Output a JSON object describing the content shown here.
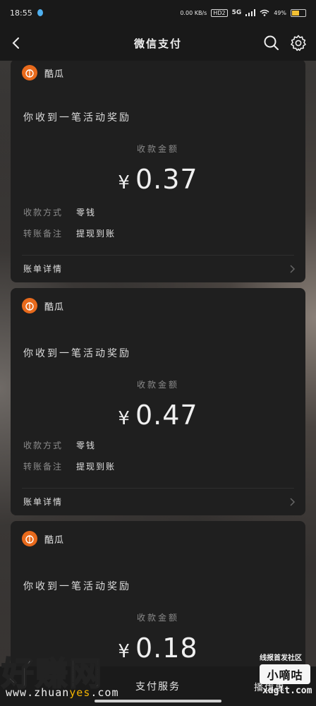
{
  "status_bar": {
    "time": "18:55",
    "net_speed": "0.00 KB/s",
    "hd_badge": "HD2",
    "network": "5G",
    "battery": "49%",
    "battery_level": 0.49
  },
  "nav": {
    "title": "微信支付",
    "back_icon": "chevron-left-icon",
    "search_icon": "search-icon",
    "settings_icon": "gear-icon"
  },
  "cards": [
    {
      "app_name": "酷瓜",
      "title": "你收到一笔活动奖励",
      "amount_label": "收款金额",
      "currency": "¥",
      "amount": "0.37",
      "method_label": "收款方式",
      "method_value": "零钱",
      "note_label": "转账备注",
      "note_value": "提现到账",
      "detail_label": "账单详情"
    },
    {
      "app_name": "酷瓜",
      "title": "你收到一笔活动奖励",
      "amount_label": "收款金额",
      "currency": "¥",
      "amount": "0.47",
      "method_label": "收款方式",
      "method_value": "零钱",
      "note_label": "转账备注",
      "note_value": "提现到账",
      "detail_label": "账单详情"
    },
    {
      "app_name": "酷瓜",
      "title": "你收到一笔活动奖励",
      "amount_label": "收款金额",
      "currency": "¥",
      "amount": "0.18"
    }
  ],
  "bottom_bar": {
    "center": "支付服务",
    "right": "播优惠"
  },
  "watermarks": {
    "left_big": "好赚网",
    "left_url_a": "www.zhuan",
    "left_url_b": "yes",
    "left_url_c": ".com",
    "right_top": "线报首发社区",
    "right_box": "小嘀咕",
    "right_url": "xdglt.com"
  },
  "colors": {
    "card_bg": "#1f1f1f",
    "app_logo": "#e86a1c",
    "battery_fill": "#f2c033"
  }
}
